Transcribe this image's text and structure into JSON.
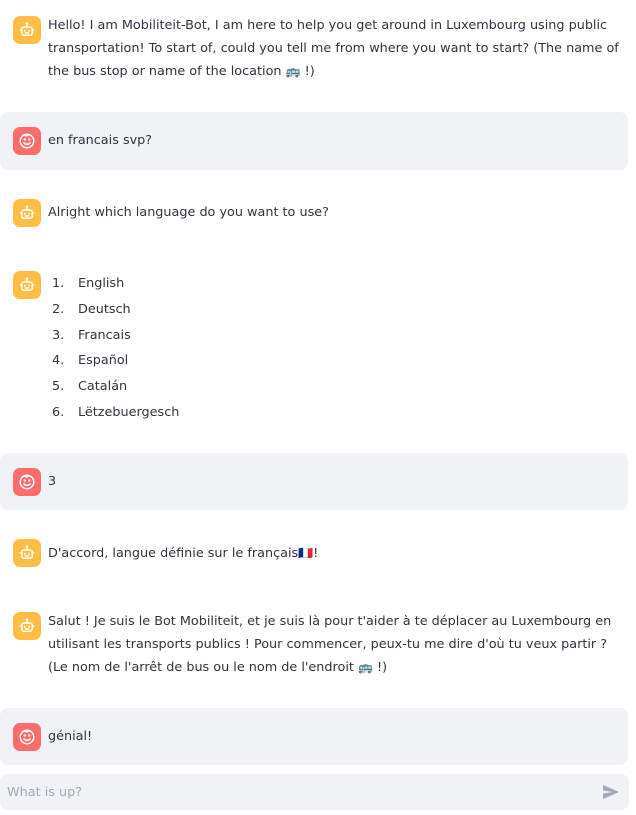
{
  "messages": [
    {
      "role": "assistant",
      "text": "Hello! I am Mobiliteit-Bot, I am here to help you get around in Luxembourg using public transportation! To start of, could you tell me from where you want to start? (The name of the bus stop or name of the location",
      "emoji": "🚌",
      "suffix": "!)"
    },
    {
      "role": "user",
      "text": "en francais svp?"
    },
    {
      "role": "assistant",
      "text": "Alright which language do you want to use?"
    },
    {
      "role": "assistant",
      "list": [
        {
          "num": "1.",
          "label": "English"
        },
        {
          "num": "2.",
          "label": "Deutsch"
        },
        {
          "num": "3.",
          "label": "Francais"
        },
        {
          "num": "4.",
          "label": "Español"
        },
        {
          "num": "5.",
          "label": "Catalán"
        },
        {
          "num": "6.",
          "label": "Lëtzebuergesch"
        }
      ]
    },
    {
      "role": "user",
      "text": "3"
    },
    {
      "role": "assistant",
      "text": "D'accord, langue définie sur le français",
      "emoji": "🇫🇷",
      "suffix": "!"
    },
    {
      "role": "assistant",
      "text": "Salut ! Je suis le Bot Mobiliteit, et je suis là pour t'aider à te déplacer au Luxembourg en utilisant les transports publics ! Pour commencer, peux-tu me dire d'où tu veux partir ? (Le nom de l'arrêt de bus ou le nom de l'endroit",
      "emoji": "🚌",
      "suffix": "!)"
    },
    {
      "role": "user",
      "text": "génial!"
    }
  ],
  "input": {
    "placeholder": "What is up?",
    "value": ""
  },
  "icons": {
    "assistant_avatar": "robot-face-icon",
    "user_avatar": "smiley-face-icon",
    "send": "send-arrow-icon"
  },
  "colors": {
    "assistant_avatar": "#ffbd45",
    "user_avatar": "#ff6c6c",
    "user_bubble": "#f0f2f6",
    "text": "#31333f",
    "placeholder": "#a3a8b4"
  }
}
